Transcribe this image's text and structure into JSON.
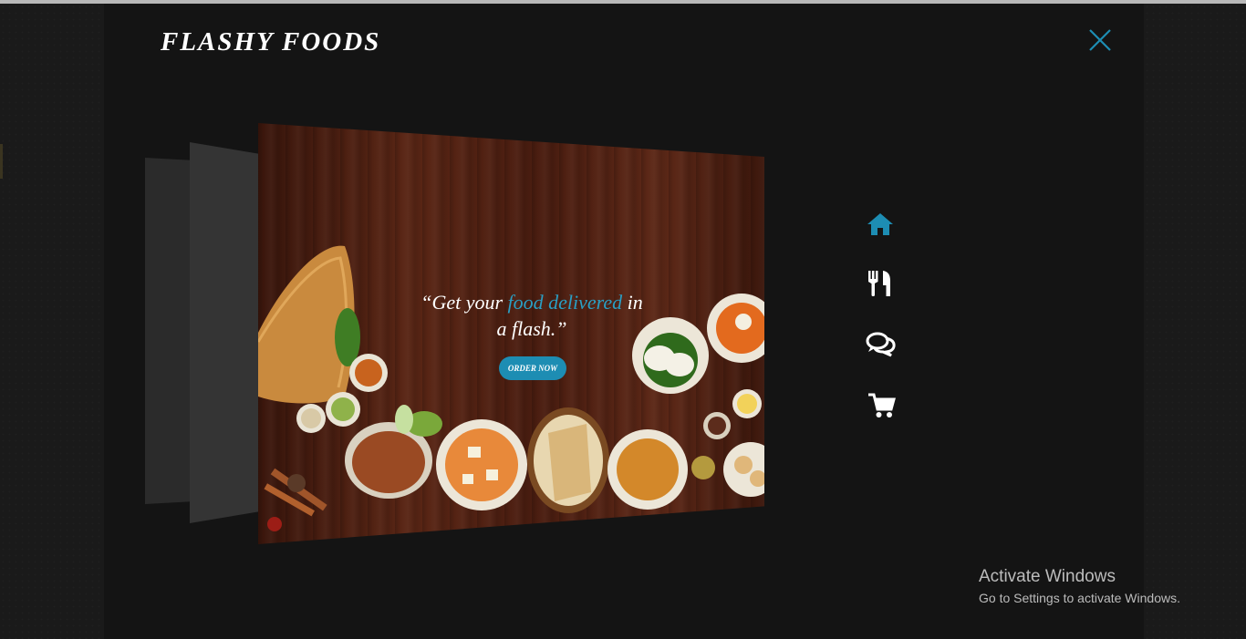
{
  "brand": {
    "title": "FLASHY FOODS"
  },
  "hero": {
    "tagline_before": "“Get your ",
    "tagline_highlight": "food delivered",
    "tagline_after": " in a flash.”",
    "order_button": "ORDER NOW"
  },
  "nav": {
    "items": [
      {
        "icon": "home-icon",
        "color": "#1d8db3",
        "active": true
      },
      {
        "icon": "cutlery-icon",
        "color": "#ffffff",
        "active": false
      },
      {
        "icon": "comments-icon",
        "color": "#ffffff",
        "active": false
      },
      {
        "icon": "shopping-cart-icon",
        "color": "#ffffff",
        "active": false
      }
    ]
  },
  "close": {
    "icon": "close-icon",
    "color": "#1d8db3"
  },
  "watermark": {
    "title": "Activate Windows",
    "subtitle": "Go to Settings to activate Windows."
  },
  "colors": {
    "accent": "#1d8db3",
    "panel": "#141414"
  }
}
